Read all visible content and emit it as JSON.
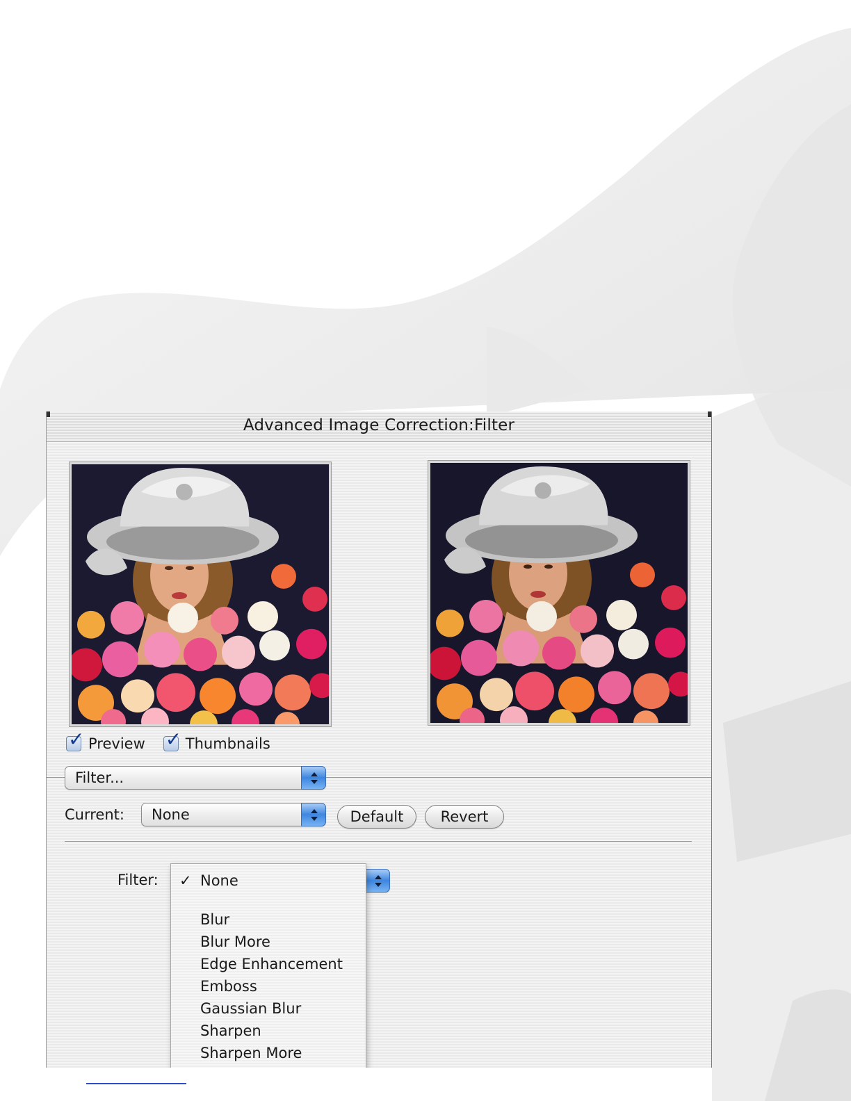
{
  "window": {
    "title": "Advanced Image Correction:Filter"
  },
  "panes": {
    "original_label": "original preview image",
    "filtered_label": "filtered preview image"
  },
  "checkboxes": [
    {
      "label": "Preview",
      "checked": true
    },
    {
      "label": "Thumbnails",
      "checked": true
    }
  ],
  "mode_popup": {
    "value": "Filter..."
  },
  "current": {
    "label": "Current:",
    "value": "None",
    "default_label": "Default",
    "revert_label": "Revert"
  },
  "filter": {
    "label": "Filter:",
    "selected": "None",
    "check_mark": "✓",
    "options": [
      "Blur",
      "Blur More",
      "Edge Enhancement",
      "Emboss",
      "Gaussian Blur",
      "Sharpen",
      "Sharpen More"
    ]
  },
  "colors": {
    "accent_blue": "#3d86e0",
    "window_bg": "#f4f4f4"
  }
}
